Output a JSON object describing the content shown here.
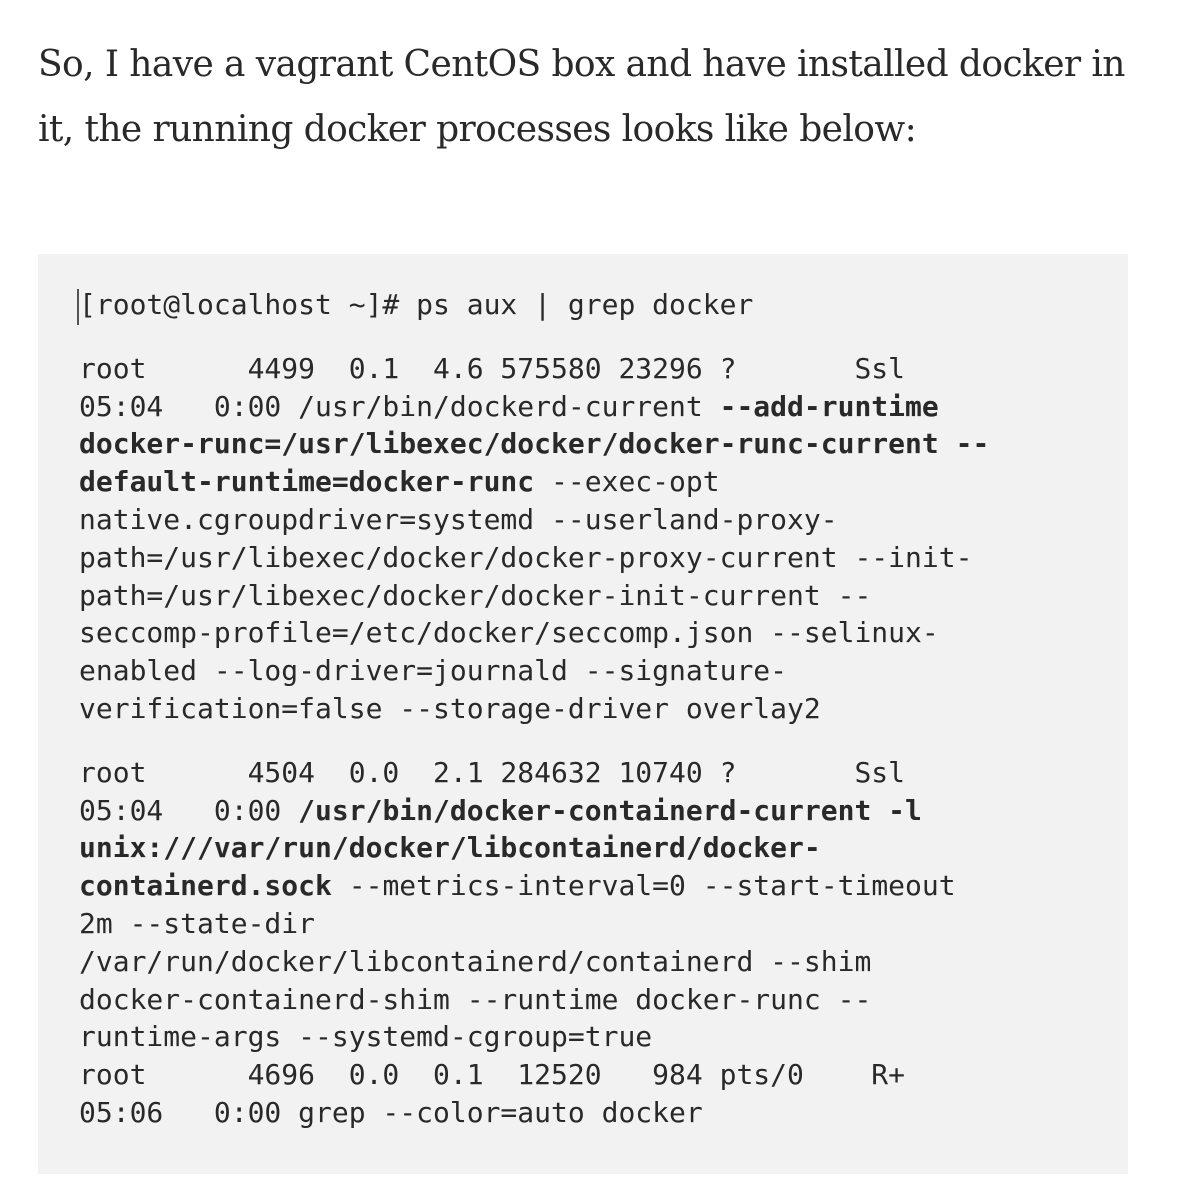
{
  "intro": {
    "line1": "So, I have a vagrant CentOS box and have installed docker in",
    "line2": "it, the running docker processes looks like below:"
  },
  "code_lines": [
    [
      {
        "t": "[root@localhost ~]# ps aux | grep docker",
        "b": false
      }
    ],
    [
      {
        "t": "root      4499  0.1  4.6 575580 23296 ?       Ssl",
        "b": false
      }
    ],
    [
      {
        "t": "05:04   0:00 /usr/bin/dockerd-current ",
        "b": false
      },
      {
        "t": "--add-runtime",
        "b": true
      }
    ],
    [
      {
        "t": "docker-runc=/usr/libexec/docker/docker-runc-current --",
        "b": true
      }
    ],
    [
      {
        "t": "default-runtime=docker-runc",
        "b": true
      },
      {
        "t": " --exec-opt",
        "b": false
      }
    ],
    [
      {
        "t": "native.cgroupdriver=systemd --userland-proxy-",
        "b": false
      }
    ],
    [
      {
        "t": "path=/usr/libexec/docker/docker-proxy-current --init-",
        "b": false
      }
    ],
    [
      {
        "t": "path=/usr/libexec/docker/docker-init-current --",
        "b": false
      }
    ],
    [
      {
        "t": "seccomp-profile=/etc/docker/seccomp.json --selinux-",
        "b": false
      }
    ],
    [
      {
        "t": "enabled --log-driver=journald --signature-",
        "b": false
      }
    ],
    [
      {
        "t": "verification=false --storage-driver overlay2",
        "b": false
      }
    ],
    [
      {
        "t": "root      4504  0.0  2.1 284632 10740 ?       Ssl",
        "b": false
      }
    ],
    [
      {
        "t": "05:04   0:00 ",
        "b": false
      },
      {
        "t": "/usr/bin/docker-containerd-current -l",
        "b": true
      }
    ],
    [
      {
        "t": "unix:///var/run/docker/libcontainerd/docker-",
        "b": true
      }
    ],
    [
      {
        "t": "containerd.sock",
        "b": true
      },
      {
        "t": " --metrics-interval=0 --start-timeout",
        "b": false
      }
    ],
    [
      {
        "t": "2m --state-dir",
        "b": false
      }
    ],
    [
      {
        "t": "/var/run/docker/libcontainerd/containerd --shim",
        "b": false
      }
    ],
    [
      {
        "t": "docker-containerd-shim --runtime docker-runc --",
        "b": false
      }
    ],
    [
      {
        "t": "runtime-args --systemd-cgroup=true",
        "b": false
      }
    ],
    [
      {
        "t": "root      4696  0.0  0.1  12520   984 pts/0    R+",
        "b": false
      }
    ],
    [
      {
        "t": "05:06   0:00 grep --color=auto docker",
        "b": false
      }
    ]
  ]
}
